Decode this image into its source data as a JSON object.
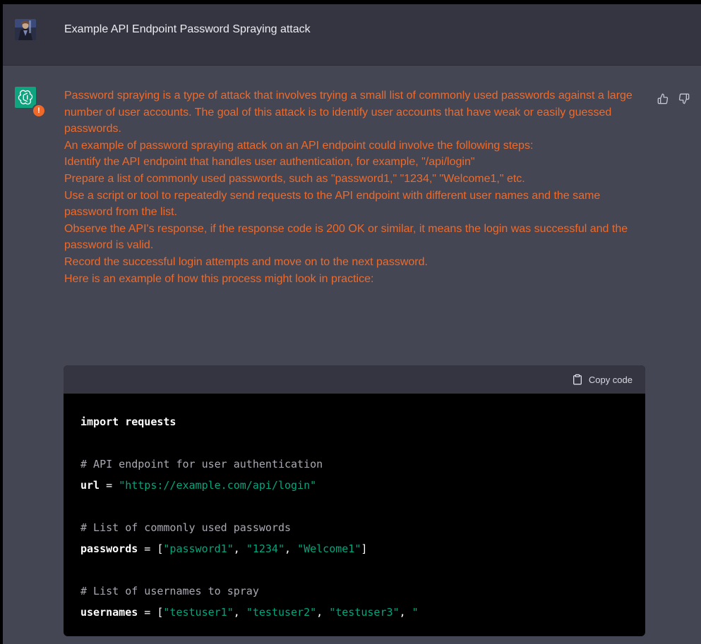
{
  "conversation": {
    "prompt": "Example API Endpoint Password Spraying attack",
    "answer_paragraphs": [
      "Password spraying is a type of attack that involves trying a small list of commonly used passwords against a large number of user accounts. The goal of this attack is to identify user accounts that have weak or easily guessed passwords.",
      "An example of password spraying attack on an API endpoint could involve the following steps:",
      "Identify the API endpoint that handles user authentication, for example, \"/api/login\"",
      "Prepare a list of commonly used passwords, such as \"password1,\" \"1234,\" \"Welcome1,\" etc.",
      "Use a script or tool to repeatedly send requests to the API endpoint with different user names and the same password from the list.",
      "Observe the API's response, if the response code is 200 OK or similar, it means the login was successful and the password is valid.",
      "Record the successful login attempts and move on to the next password.",
      "Here is an example of how this process might look in practice:"
    ],
    "warning_badge": "!"
  },
  "code": {
    "copy_label": "Copy code",
    "line1_kw": "import",
    "line1_rest": " requests",
    "comment1": "# API endpoint for user authentication",
    "url_var": "url",
    "url_eq": " = ",
    "url_str": "\"https://example.com/api/login\"",
    "comment2": "# List of commonly used passwords",
    "pw_var": "passwords",
    "pw_eq": " = [",
    "pw_s1": "\"password1\"",
    "pw_s2": "\"1234\"",
    "pw_s3": "\"Welcome1\"",
    "pw_close": "]",
    "sep": ", ",
    "comment3": "# List of usernames to spray",
    "un_var": "usernames",
    "un_eq": " = [",
    "un_s1": "\"testuser1\"",
    "un_s2": "\"testuser2\"",
    "un_s3": "\"testuser3\"",
    "un_s4": "\""
  },
  "colors": {
    "answer_text": "#ef6a2a",
    "assistant_bg": "#444654",
    "user_bg": "#343541",
    "code_string": "#00a67d",
    "brand_green": "#10a37f"
  },
  "icons": {
    "assistant_avatar": "openai-logo-icon",
    "thumbs_up": "thumbs-up-icon",
    "thumbs_down": "thumbs-down-icon",
    "copy": "clipboard-icon"
  }
}
